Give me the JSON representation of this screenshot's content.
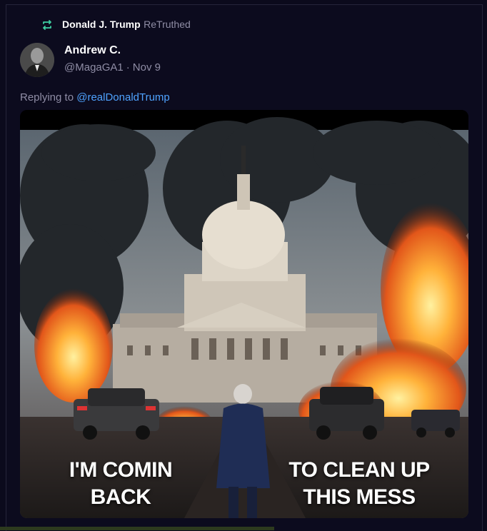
{
  "retruth": {
    "icon": "retruth-icon",
    "name": "Donald J. Trump",
    "label": "ReTruthed",
    "accent": "#3fd0a2"
  },
  "author": {
    "name": "Andrew C.",
    "handle": "@MagaGA1",
    "separator": "·",
    "date": "Nov 9"
  },
  "reply": {
    "prefix": "Replying to",
    "mention": "@realDonaldTrump",
    "link_color": "#4fa3ff"
  },
  "media": {
    "caption_left": "I'M COMIN BACK",
    "caption_right": "TO CLEAN UP THIS MESS"
  }
}
